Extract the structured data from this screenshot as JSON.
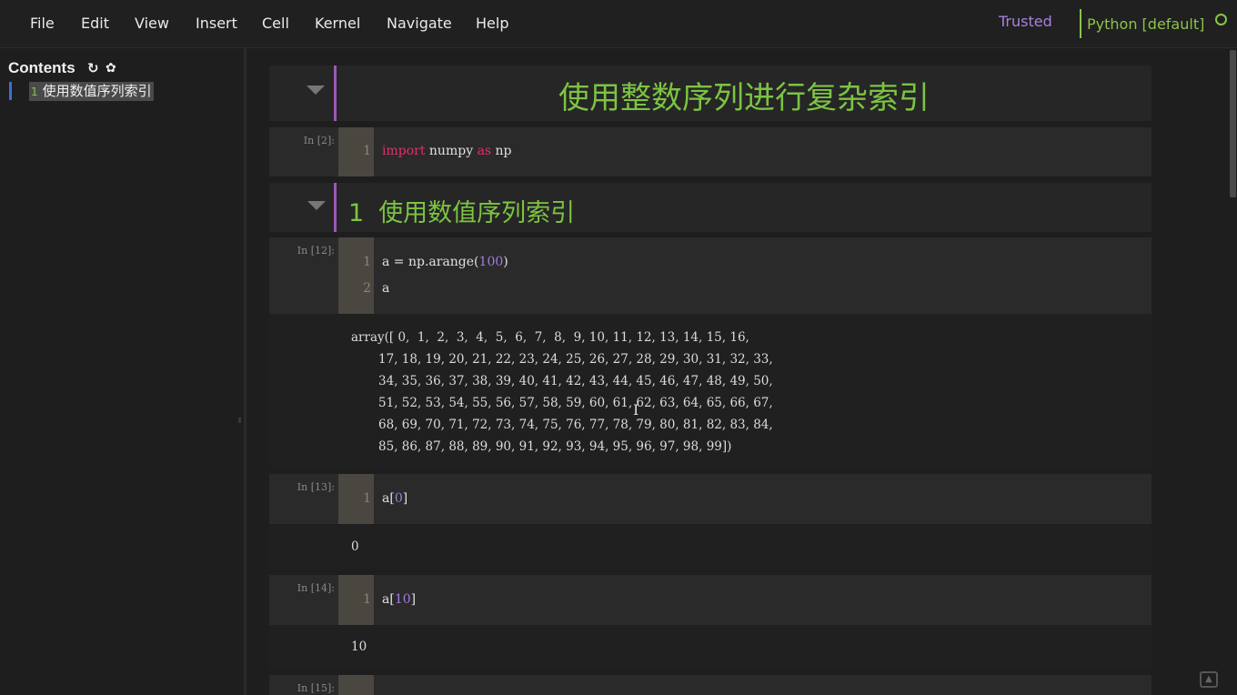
{
  "menubar": {
    "items": [
      "File",
      "Edit",
      "View",
      "Insert",
      "Cell",
      "Kernel",
      "Navigate",
      "Help"
    ],
    "trusted": "Trusted",
    "kernel_name": "Python [default]",
    "kernel_indicator_icon": "circle-idle-icon"
  },
  "toc": {
    "title": "Contents",
    "refresh_icon": "↻",
    "settings_icon": "✿",
    "items": [
      {
        "number": "1",
        "label": "使用数值序列索引"
      }
    ]
  },
  "notebook": {
    "title_cell": {
      "text": "使用整数序列进行复杂索引"
    },
    "cell_import": {
      "prompt": "In [2]:",
      "lines": [
        {
          "no": "1",
          "kw1": "import",
          "mid": " numpy ",
          "kw2": "as",
          "tail": " np"
        }
      ]
    },
    "heading_cell": {
      "number": "1",
      "text": "使用数值序列索引"
    },
    "cell_arange": {
      "prompt": "In [12]:",
      "line1": {
        "no": "1",
        "pre": "a = np.arange(",
        "num": "100",
        "post": ")"
      },
      "line2": {
        "no": "2",
        "text": "a"
      },
      "output": [
        "array([ 0,  1,  2,  3,  4,  5,  6,  7,  8,  9, 10, 11, 12, 13, 14, 15, 16,",
        "       17, 18, 19, 20, 21, 22, 23, 24, 25, 26, 27, 28, 29, 30, 31, 32, 33,",
        "       34, 35, 36, 37, 38, 39, 40, 41, 42, 43, 44, 45, 46, 47, 48, 49, 50,",
        "       51, 52, 53, 54, 55, 56, 57, 58, 59, 60, 61, 62, 63, 64, 65, 66, 67,",
        "       68, 69, 70, 71, 72, 73, 74, 75, 76, 77, 78, 79, 80, 81, 82, 83, 84,",
        "       85, 86, 87, 88, 89, 90, 91, 92, 93, 94, 95, 96, 97, 98, 99])"
      ]
    },
    "cell_a0": {
      "prompt": "In [13]:",
      "line": {
        "no": "1",
        "pre": "a[",
        "num": "0",
        "post": "]"
      },
      "output": "0"
    },
    "cell_a10": {
      "prompt": "In [14]:",
      "line": {
        "no": "1",
        "pre": "a[",
        "num": "10",
        "post": "]"
      },
      "output": "10"
    },
    "cell_partial": {
      "prompt": "In [15]:"
    }
  },
  "colors": {
    "accent_green": "#8bc34a",
    "trusted_purple": "#a681e0",
    "keyword": "#e0306c",
    "number": "#a07cdf"
  }
}
